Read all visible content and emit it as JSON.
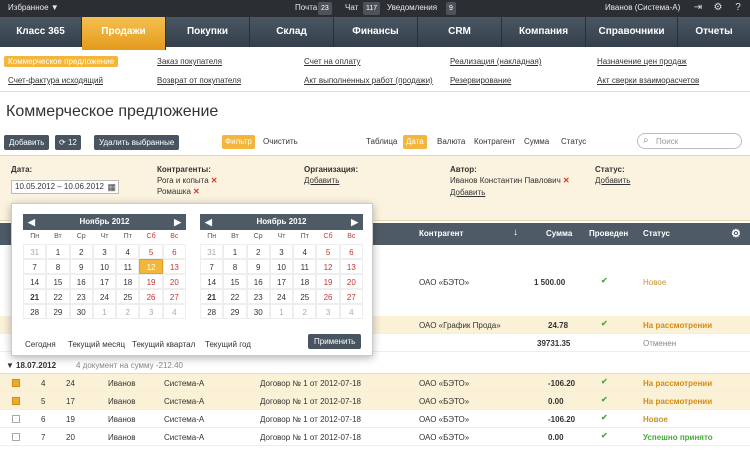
{
  "topbar": {
    "favorites": "Избранное ▼",
    "mail_label": "Почта",
    "mail_count": "23",
    "chat_label": "Чат",
    "chat_count": "117",
    "notif_label": "Уведомления",
    "notif_count": "9",
    "user": "Иванов (Система-А)"
  },
  "nav": [
    {
      "label": "Класс 365"
    },
    {
      "label": "Продажи"
    },
    {
      "label": "Покупки"
    },
    {
      "label": "Склад"
    },
    {
      "label": "Финансы"
    },
    {
      "label": "CRM"
    },
    {
      "label": "Компания"
    },
    {
      "label": "Справочники"
    },
    {
      "label": "Отчеты"
    }
  ],
  "sublinks": [
    "Коммерческое предложение",
    "Счет-фактура исходящий",
    "Заказ покупателя",
    "Возврат от покупателя",
    "Счет на оплату",
    "Акт выполненных работ (продажи)",
    "Реализация (накладная)",
    "Резервирование",
    "Назначение цен продаж",
    "Акт сверки взаиморасчетов"
  ],
  "page_title": "Коммерческое предложение",
  "toolbar": {
    "add": "Добавить",
    "refresh_count": "12",
    "delete": "Удалить выбранные",
    "filter": "Фильтр",
    "clear": "Очистить"
  },
  "view_tabs": [
    "Таблица",
    "Дата",
    "Валюта",
    "Контрагент",
    "Сумма",
    "Статус"
  ],
  "search": {
    "placeholder": "Поиск"
  },
  "filter": {
    "date_label": "Дата:",
    "date_value": "10.05.2012 – 10.06.2012",
    "contr_label": "Контрагенты:",
    "contr1": "Рога и копыта",
    "contr2": "Ромашка",
    "org_label": "Организация:",
    "add": "Добавить",
    "author_label": "Автор:",
    "author_value": "Иванов Константин Павлович",
    "status_label": "Статус:"
  },
  "table": {
    "h_contr": "Контрагент",
    "h_sort": "↓",
    "h_sum": "Сумма",
    "h_posted": "Проведен",
    "h_status": "Статус"
  },
  "upper_rows": [
    {
      "contr": "ОАО «БЭТО»",
      "sum": "1 500.00",
      "status": "Новое",
      "status_color": "#c8922a"
    },
    {
      "contr": "ОАО «График Прода»",
      "sum": "24.78",
      "status": "На рассмотрении",
      "status_color": "#d68b14"
    },
    {
      "contr": "",
      "sum": "39731.35",
      "status": "Отменен",
      "status_color": "#888888"
    }
  ],
  "group": {
    "date": "18.07.2012",
    "info": "4 документ на сумму -212.40"
  },
  "rows": [
    {
      "n": "4",
      "num": "24",
      "user": "Иванов",
      "org": "Система-А",
      "doc": "Договор № 1 от 2012-07-18",
      "contr": "ОАО «БЭТО»",
      "sum": "-106.20",
      "status": "На рассмотрении",
      "status_color": "#d68b14"
    },
    {
      "n": "5",
      "num": "17",
      "user": "Иванов",
      "org": "Система-А",
      "doc": "Договор № 1 от 2012-07-18",
      "contr": "ОАО «БЭТО»",
      "sum": "0.00",
      "status": "На рассмотрении",
      "status_color": "#d68b14"
    },
    {
      "n": "6",
      "num": "19",
      "user": "Иванов",
      "org": "Система-А",
      "doc": "Договор № 1 от 2012-07-18",
      "contr": "ОАО «БЭТО»",
      "sum": "-106.20",
      "status": "Новое",
      "status_color": "#c8922a"
    },
    {
      "n": "7",
      "num": "20",
      "user": "Иванов",
      "org": "Система-А",
      "doc": "Договор № 1 от 2012-07-18",
      "contr": "ОАО «БЭТО»",
      "sum": "0.00",
      "status": "Успешно принято",
      "status_color": "#4aaa3c"
    }
  ],
  "calendar": {
    "month_title": "Ноябрь 2012",
    "dow": [
      "Пн",
      "Вт",
      "Ср",
      "Чт",
      "Пт",
      "Сб",
      "Вс"
    ],
    "links": [
      "Сегодня",
      "Текущий месяц",
      "Текущий квартал",
      "Текущий год"
    ],
    "apply": "Применить"
  },
  "cal_left": [
    "31",
    "1",
    "2",
    "3",
    "4",
    "5",
    "6",
    "7",
    "8",
    "9",
    "10",
    "11",
    "12",
    "13",
    "14",
    "15",
    "16",
    "17",
    "18",
    "19",
    "20",
    "21",
    "22",
    "23",
    "24",
    "25",
    "26",
    "27",
    "28",
    "29",
    "30",
    "1",
    "2",
    "3",
    "4"
  ],
  "cal_right": [
    "31",
    "1",
    "2",
    "3",
    "4",
    "5",
    "6",
    "7",
    "8",
    "9",
    "10",
    "11",
    "12",
    "13",
    "14",
    "15",
    "16",
    "17",
    "18",
    "19",
    "20",
    "21",
    "22",
    "23",
    "24",
    "25",
    "26",
    "27",
    "28",
    "29",
    "30",
    "1",
    "2",
    "3",
    "4"
  ]
}
